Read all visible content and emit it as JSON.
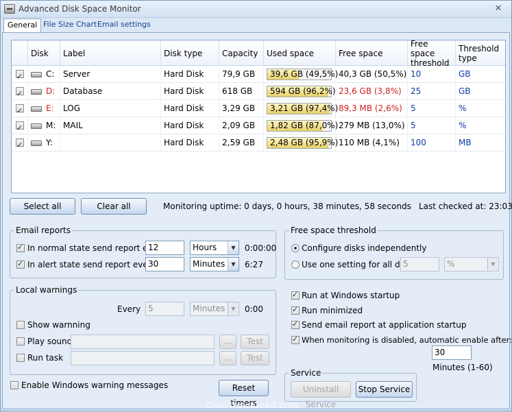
{
  "window": {
    "title": "Advanced Disk Space Monitor",
    "close_glyph": "✕"
  },
  "tabs": [
    {
      "label": "General"
    },
    {
      "label": "File Size Chart"
    },
    {
      "label": "Email settings"
    }
  ],
  "grid": {
    "columns": [
      "Disk",
      "Label",
      "Disk type",
      "Capacity",
      "Used space",
      "Free space",
      "Free space threshold",
      "Threshold type"
    ],
    "rows": [
      {
        "checked": true,
        "disk": "C:",
        "label": "Server",
        "type": "Hard Disk",
        "capacity": "79,9 GB",
        "used": "39,6 GB (49,5%)",
        "used_fraction": 0.495,
        "free": "40,3 GB (50,5%)",
        "alert": false,
        "threshold": "10",
        "threshold_type": "GB"
      },
      {
        "checked": true,
        "disk": "D:",
        "label": "Database",
        "type": "Hard Disk",
        "capacity": "618 GB",
        "used": "594 GB (96,2%)",
        "used_fraction": 0.962,
        "free": "23,6 GB (3,8%)",
        "alert": true,
        "threshold": "25",
        "threshold_type": "GB"
      },
      {
        "checked": true,
        "disk": "E:",
        "label": "LOG",
        "type": "Hard Disk",
        "capacity": "3,29 GB",
        "used": "3,21 GB (97,4%)",
        "used_fraction": 0.974,
        "free": "89,3 MB (2,6%)",
        "alert": true,
        "threshold": "5",
        "threshold_type": "%"
      },
      {
        "checked": true,
        "disk": "M:",
        "label": "MAIL",
        "type": "Hard Disk",
        "capacity": "2,09 GB",
        "used": "1,82 GB (87,0%)",
        "used_fraction": 0.87,
        "free": "279 MB (13,0%)",
        "alert": false,
        "threshold": "5",
        "threshold_type": "%"
      },
      {
        "checked": true,
        "disk": "Y:",
        "label": "",
        "type": "Hard Disk",
        "capacity": "2,59 GB",
        "used": "2,48 GB (95,9%)",
        "used_fraction": 0.959,
        "free": "110 MB (4,1%)",
        "alert": false,
        "threshold": "100",
        "threshold_type": "MB"
      }
    ]
  },
  "actions": {
    "select_all": "Select all",
    "clear_all": "Clear all",
    "uptime": "Monitoring uptime: 0 days, 0 hours, 38 minutes, 58 seconds",
    "last_checked": "Last checked at: 23:03:36"
  },
  "email_reports": {
    "legend": "Email reports",
    "normal": {
      "label": "In normal state send report every",
      "checked": true,
      "value": "12",
      "unit": "Hours",
      "countdown": "0:00:00"
    },
    "alert": {
      "label": "In alert state send report every",
      "checked": true,
      "value": "30",
      "unit": "Minutes",
      "countdown": "6:27"
    }
  },
  "free_space_threshold": {
    "legend": "Free space threshold",
    "option_independent": "Configure disks independently",
    "option_single": "Use one setting for all disks",
    "selected": "independent",
    "value": "5",
    "unit": "%"
  },
  "local_warnings": {
    "legend": "Local warnings",
    "every_label": "Every",
    "every_value": "5",
    "every_unit": "Minutes",
    "countdown": "0:00",
    "show_warning": "Show warnning",
    "play_sound": "Play sound",
    "run_task": "Run task",
    "browse": "...",
    "test": "Test"
  },
  "startup": {
    "run_at_startup": "Run at Windows startup",
    "run_minimized": "Run minimized",
    "send_report": "Send email report at application startup",
    "auto_enable": "When monitoring is disabled, automatic enable after:",
    "auto_enable_value": "30",
    "auto_enable_hint": "Minutes (1-60)"
  },
  "bottom": {
    "enable_windows_messages": "Enable Windows warning messages",
    "reset_timers": "Reset timers"
  },
  "service": {
    "legend": "Service",
    "uninstall": "Uninstall Service",
    "stop": "Stop Service"
  },
  "watermark": "GearDownload.com",
  "colors": {
    "alert_text": "#cc2020",
    "threshold_text": "#0a3ca8",
    "bar_fill": "#e8d06a"
  }
}
